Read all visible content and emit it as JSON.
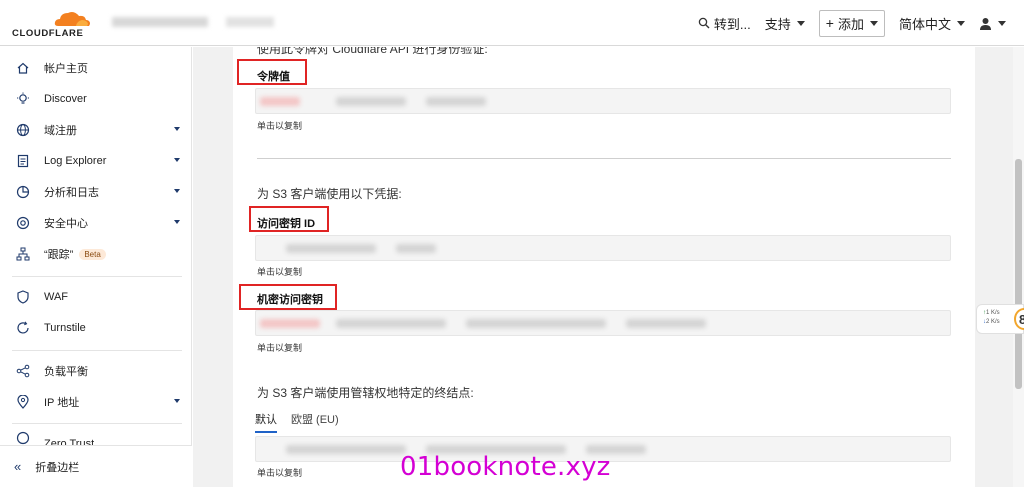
{
  "brand": {
    "logo_text": "CLOUDFLARE",
    "accent": "#f38020"
  },
  "topbar": {
    "goto_label": "转到...",
    "support_label": "支持",
    "add_label": "添加",
    "language_label": "简体中文"
  },
  "sidebar": {
    "items": [
      {
        "label": "帐户主页",
        "icon": "home-icon",
        "dropdown": false
      },
      {
        "label": "Discover",
        "icon": "lightbulb-icon",
        "dropdown": false
      },
      {
        "label": "域注册",
        "icon": "globe-icon",
        "dropdown": true
      },
      {
        "label": "Log Explorer",
        "icon": "document-icon",
        "dropdown": true
      },
      {
        "label": "分析和日志",
        "icon": "chart-icon",
        "dropdown": true
      },
      {
        "label": "安全中心",
        "icon": "target-icon",
        "dropdown": true
      },
      {
        "label": "“跟踪”",
        "icon": "network-icon",
        "dropdown": false,
        "badge": "Beta"
      },
      {
        "label": "WAF",
        "icon": "shield-icon",
        "dropdown": false
      },
      {
        "label": "Turnstile",
        "icon": "refresh-icon",
        "dropdown": false
      },
      {
        "label": "负载平衡",
        "icon": "share-icon",
        "dropdown": false
      },
      {
        "label": "IP 地址",
        "icon": "location-icon",
        "dropdown": true
      },
      {
        "label": "Zero Trust",
        "icon": "zero-trust-icon",
        "dropdown": false
      }
    ],
    "collapse_label": "折叠边栏"
  },
  "main": {
    "intro_text": "使用此令牌对 Cloudflare API 进行身份验证:",
    "token": {
      "label": "令牌值",
      "hint": "单击以复制"
    },
    "s3_intro": "为 S3 客户端使用以下凭据:",
    "access_key": {
      "label": "访问密钥 ID",
      "hint": "单击以复制"
    },
    "secret_key": {
      "label": "机密访问密钥",
      "hint": "单击以复制"
    },
    "endpoint_intro": "为 S3 客户端使用管辖权地特定的终结点:",
    "tabs": [
      "默认",
      "欧盟 (EU)"
    ],
    "active_tab": "默认",
    "endpoint": {
      "hint": "单击以复制"
    }
  },
  "speed_widget": {
    "up": "1",
    "up_unit": "K/s",
    "down": "2",
    "down_unit": "K/s",
    "badge": "8"
  },
  "watermark": "01booknote.xyz"
}
